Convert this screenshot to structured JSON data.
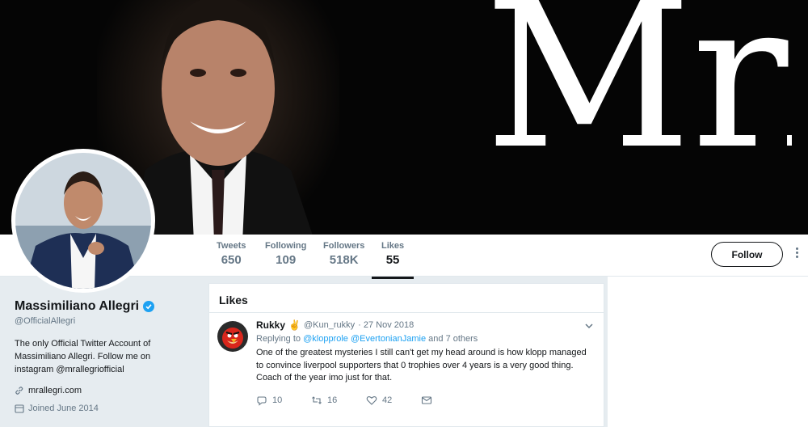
{
  "banner": {
    "monogram": "MrA"
  },
  "nav": {
    "stats": [
      {
        "label": "Tweets",
        "value": "650"
      },
      {
        "label": "Following",
        "value": "109"
      },
      {
        "label": "Followers",
        "value": "518K"
      },
      {
        "label": "Likes",
        "value": "55"
      }
    ],
    "follow_label": "Follow"
  },
  "profile": {
    "name": "Massimiliano Allegri",
    "handle": "@OfficialAllegri",
    "bio": "The only Official Twitter Account of Massimiliano Allegri. Follow me on instagram @mrallegriofficial",
    "website": "mrallegri.com",
    "joined": "Joined June 2014"
  },
  "likes": {
    "heading": "Likes",
    "tweet": {
      "name": "Rukky",
      "emoji": "✌",
      "handle": "@Kun_rukky",
      "date": "· 27 Nov 2018",
      "replying_prefix": "Replying to",
      "mention1": "@klopprole",
      "mention2": "@EvertonianJamie",
      "replying_suffix": "and 7 others",
      "text": "One of the greatest mysteries I still can't get my head around is how klopp managed to convince liverpool supporters that 0 trophies over 4 years is a very good thing. Coach of the year imo just for that.",
      "replies": "10",
      "retweets": "16",
      "likes": "42"
    }
  },
  "icons": [
    "verified-icon",
    "link-icon",
    "calendar-icon",
    "reply-icon",
    "retweet-icon",
    "heart-icon",
    "message-icon",
    "chevron-down-icon",
    "more-icon"
  ],
  "colors": {
    "accent": "#1da1f2",
    "text": "#14171a",
    "muted": "#657786",
    "background": "#e6ecf0"
  }
}
